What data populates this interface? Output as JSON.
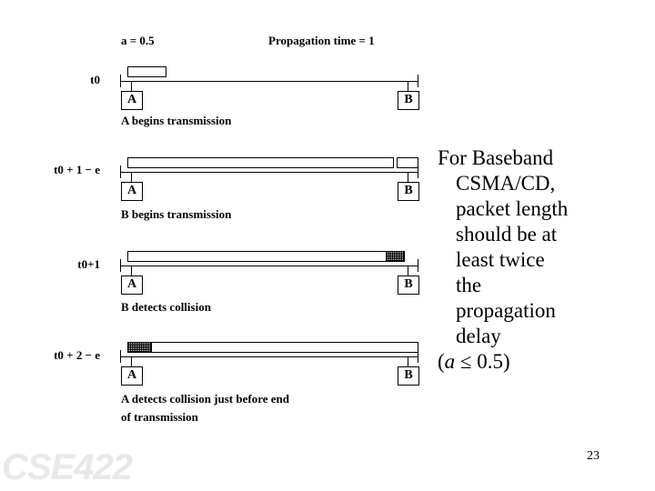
{
  "slide": {
    "page_number": "23",
    "watermark": "CSE422"
  },
  "header": {
    "alpha_label": "a = 0.5",
    "propagation_label": "Propagation time = 1"
  },
  "diagram": {
    "station_a_label": "A",
    "station_b_label": "B",
    "rows": [
      {
        "time_label": "t0",
        "caption": "A  begins transmission"
      },
      {
        "time_label": "t0 + 1 − e",
        "caption": "B  begins transmission"
      },
      {
        "time_label": "t0+1",
        "caption": "B  detects collision"
      },
      {
        "time_label": "t0 + 2 − e",
        "caption_line1": "A  detects collision just before end",
        "caption_line2": "of transmission"
      }
    ]
  },
  "explanation": {
    "line1": "For Baseband",
    "line2": "CSMA/CD,",
    "line3": "packet length",
    "line4": "should be at",
    "line5": "least twice",
    "line6": "the",
    "line7": "propagation",
    "line8": "delay",
    "line9_open": "(",
    "line9_var": "a",
    "line9_rest": " ≤ 0.5)"
  }
}
